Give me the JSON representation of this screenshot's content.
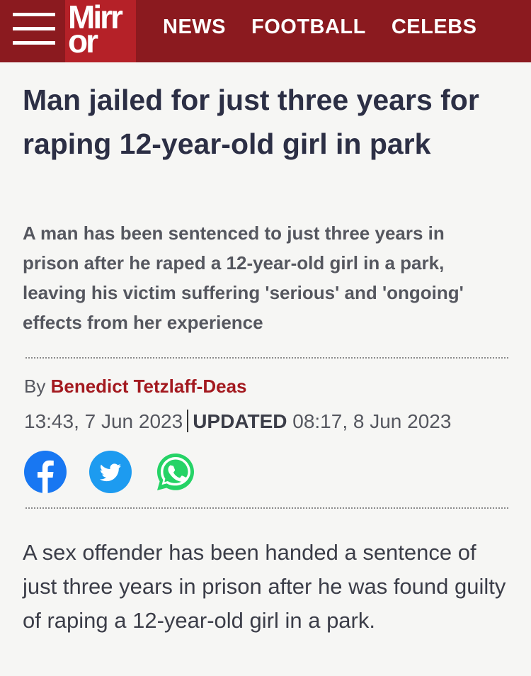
{
  "header": {
    "logo": {
      "line1": "Mirr",
      "line2": "or"
    },
    "nav": [
      "NEWS",
      "FOOTBALL",
      "CELEBS"
    ]
  },
  "article": {
    "headline": "Man jailed for just three years for raping 12-year-old girl in park",
    "standfirst": "A man has been sentenced to just three years in prison after he raped a 12-year-old girl in a park, leaving his victim suffering 'serious' and 'ongoing' effects from her experience",
    "byline_prefix": "By",
    "author": "Benedict Tetzlaff-Deas",
    "published": "13:43, 7 Jun 2023",
    "updated_label": "UPDATED",
    "updated": "08:17, 8 Jun 2023",
    "body": "A sex offender has been handed a sentence of just three years in prison after he was found guilty of raping a 12-year-old girl in a park."
  },
  "share": [
    {
      "name": "facebook-icon",
      "color": "#1877f2"
    },
    {
      "name": "twitter-icon",
      "color": "#1d9bf0"
    },
    {
      "name": "whatsapp-icon",
      "color": "#25d366"
    }
  ],
  "colors": {
    "brand": "#8b1a1f",
    "logo_bg": "#b52128",
    "author": "#a3191f"
  }
}
